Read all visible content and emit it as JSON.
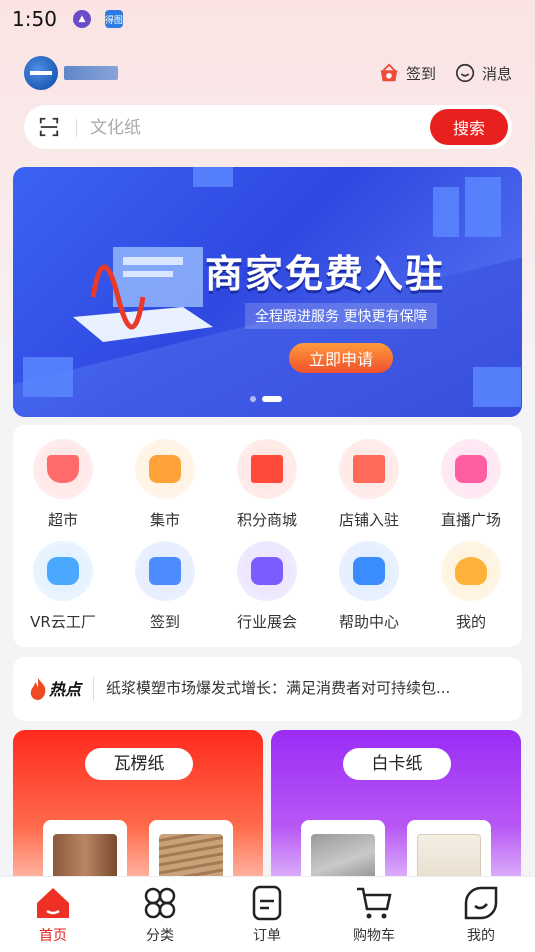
{
  "status_bar": {
    "time": "1:50",
    "app_icon_text": "得图"
  },
  "header": {
    "checkin_label": "签到",
    "message_label": "消息"
  },
  "search": {
    "placeholder": "文化纸",
    "button_label": "搜索"
  },
  "banner": {
    "title": "商家免费入驻",
    "subtitle": "全程跟进服务  更快更有保障",
    "cta": "立即申请",
    "slide_count": 2,
    "active_slide": 2
  },
  "grid": {
    "items": [
      {
        "label": "超市",
        "icon": "supermarket-basket-icon",
        "color": "#ff6b6b"
      },
      {
        "label": "集市",
        "icon": "market-bag-icon",
        "color": "#ffa23a"
      },
      {
        "label": "积分商城",
        "icon": "gift-box-icon",
        "color": "#ff4a3a"
      },
      {
        "label": "店铺入驻",
        "icon": "storefront-icon",
        "color": "#ff6a5a"
      },
      {
        "label": "直播广场",
        "icon": "live-play-icon",
        "color": "#ff5fa2"
      },
      {
        "label": "VR云工厂",
        "icon": "vr-headset-icon",
        "color": "#4aa8ff"
      },
      {
        "label": "签到",
        "icon": "calendar-icon",
        "color": "#4d8bff"
      },
      {
        "label": "行业展会",
        "icon": "exhibition-icon",
        "color": "#7c5cff"
      },
      {
        "label": "帮助中心",
        "icon": "help-chat-icon",
        "color": "#3b8cff"
      },
      {
        "label": "我的",
        "icon": "user-profile-icon",
        "color": "#ffb23a"
      }
    ]
  },
  "news": {
    "badge": "热点",
    "headline": "纸浆模塑市场爆发式增长：满足消费者对可持续包..."
  },
  "categories": [
    {
      "label": "瓦楞纸",
      "color": "#ff2a1e"
    },
    {
      "label": "白卡纸",
      "color": "#9a2cf5"
    }
  ],
  "tabbar": {
    "items": [
      {
        "label": "首页",
        "icon": "home-icon",
        "active": true
      },
      {
        "label": "分类",
        "icon": "category-grid-icon",
        "active": false
      },
      {
        "label": "订单",
        "icon": "order-document-icon",
        "active": false
      },
      {
        "label": "购物车",
        "icon": "shopping-cart-icon",
        "active": false
      },
      {
        "label": "我的",
        "icon": "profile-leaf-icon",
        "active": false
      }
    ]
  },
  "colors": {
    "accent": "#e8201e",
    "banner_blue": "#3c63f2"
  }
}
